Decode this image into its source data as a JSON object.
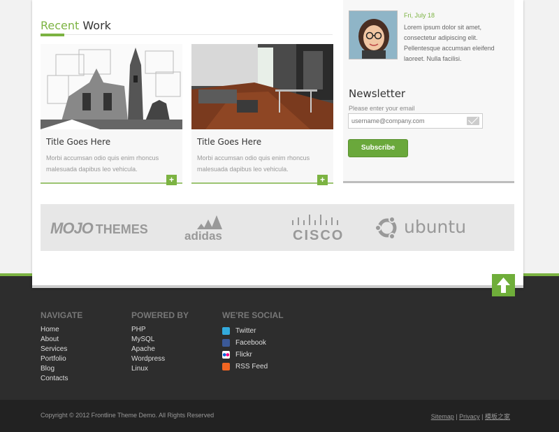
{
  "recent_work": {
    "title_accent": "Recent",
    "title_rest": "Work",
    "cards": [
      {
        "title": "Title Goes Here",
        "desc": "Morbi accumsan odio quis enim rhoncus malesuada dapibus leo vehicula.",
        "plus": "+"
      },
      {
        "title": "Title Goes Here",
        "desc": "Morbi accumsan odio quis enim rhoncus malesuada dapibus leo vehicula.",
        "plus": "+"
      }
    ]
  },
  "testimonial": {
    "date": "Fri, July 18",
    "text": "Lorem ipsum dolor sit amet, consectetur adipiscing elit. Pellentesque accumsan eleifend laoreet. Nulla facilisi."
  },
  "newsletter": {
    "title": "Newsletter",
    "label": "Please enter your email",
    "placeholder": "username@company.com",
    "button": "Subscribe"
  },
  "partners": {
    "mojo_a": "MOJO",
    "mojo_b": "THEMES",
    "adidas": "adidas",
    "cisco": "CISCO",
    "ubuntu": "ubuntu"
  },
  "footer": {
    "navigate": {
      "title": "NAVIGATE",
      "links": [
        "Home",
        "About",
        "Services",
        "Portfolio",
        "Blog",
        "Contacts"
      ]
    },
    "powered": {
      "title": "POWERED BY",
      "links": [
        "PHP",
        "MySQL",
        "Apache",
        "Wordpress",
        "Linux"
      ]
    },
    "social": {
      "title": "WE'RE SOCIAL",
      "links": [
        "Twitter",
        "Facebook",
        "Flickr",
        "RSS Feed"
      ]
    }
  },
  "bottom": {
    "copyright": "Copyright © 2012 Frontline Theme Demo. All Rights Reserved",
    "sitemap": "Sitemap",
    "privacy": "Privacy",
    "extra": "模板之家",
    "sep": "|"
  },
  "colors": {
    "accent": "#7cb342",
    "footer_bg": "#2d2d2d",
    "twitter": "#33aadd",
    "facebook": "#3b5998",
    "flickr_pink": "#ff0084",
    "flickr_blue": "#0063dc",
    "rss": "#f26522"
  }
}
